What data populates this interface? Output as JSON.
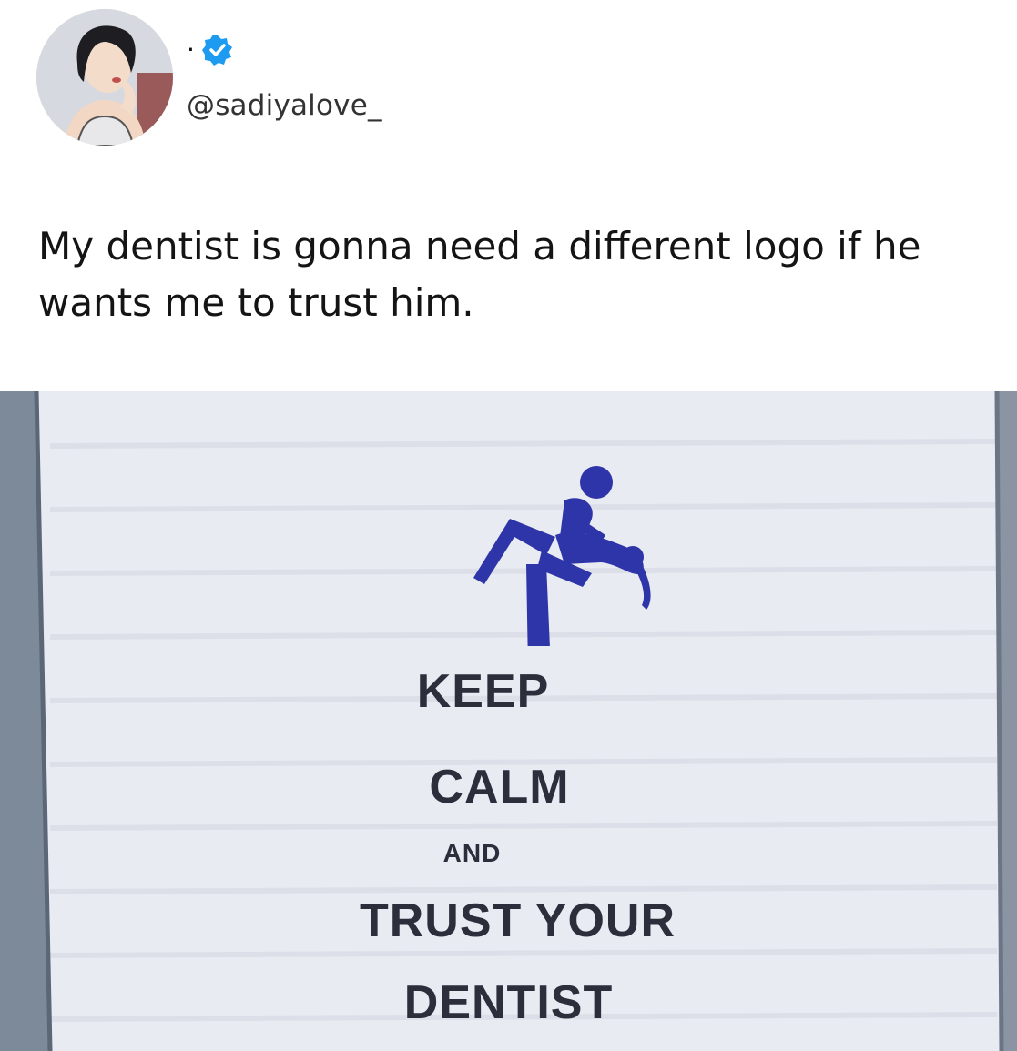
{
  "post": {
    "author": {
      "name": "·",
      "handle": "@sadiyalove_",
      "verified": true,
      "verified_icon": "verified-badge-icon",
      "verified_color": "#1d9bf0"
    },
    "text": "My dentist is gonna need a different logo if he wants me to trust him."
  },
  "sign": {
    "line1": "KEEP",
    "line2": "CALM",
    "line3": "AND",
    "line4": "TRUST YOUR",
    "line5": "DENTIST",
    "logo_icon": "dentist-figure-icon",
    "logo_color": "#2d35a8"
  }
}
